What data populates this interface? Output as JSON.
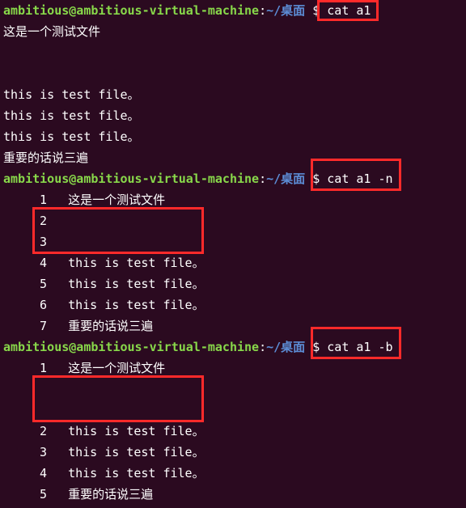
{
  "prompt": {
    "user": "ambitious@ambitious-virtual-machine",
    "sep": ":",
    "path": "~/桌面",
    "symbol": "$"
  },
  "commands": {
    "c1": "cat a1",
    "c2": "cat a1 -n",
    "c3": "cat a1 -b"
  },
  "cat_plain": {
    "l1": "这是一个测试文件",
    "l2": "",
    "l3": "",
    "l4": "this is test file。",
    "l5": "this is test file。",
    "l6": "this is test file。",
    "l7": "重要的话说三遍"
  },
  "cat_n": [
    {
      "n": "1",
      "t": "这是一个测试文件"
    },
    {
      "n": "2",
      "t": ""
    },
    {
      "n": "3",
      "t": ""
    },
    {
      "n": "4",
      "t": "this is test file。"
    },
    {
      "n": "5",
      "t": "this is test file。"
    },
    {
      "n": "6",
      "t": "this is test file。"
    },
    {
      "n": "7",
      "t": "重要的话说三遍"
    }
  ],
  "cat_b": [
    {
      "n": "1",
      "t": "这是一个测试文件"
    },
    {
      "n": "",
      "t": ""
    },
    {
      "n": "",
      "t": ""
    },
    {
      "n": "2",
      "t": "this is test file。"
    },
    {
      "n": "3",
      "t": "this is test file。"
    },
    {
      "n": "4",
      "t": "this is test file。"
    },
    {
      "n": "5",
      "t": "重要的话说三遍"
    }
  ]
}
